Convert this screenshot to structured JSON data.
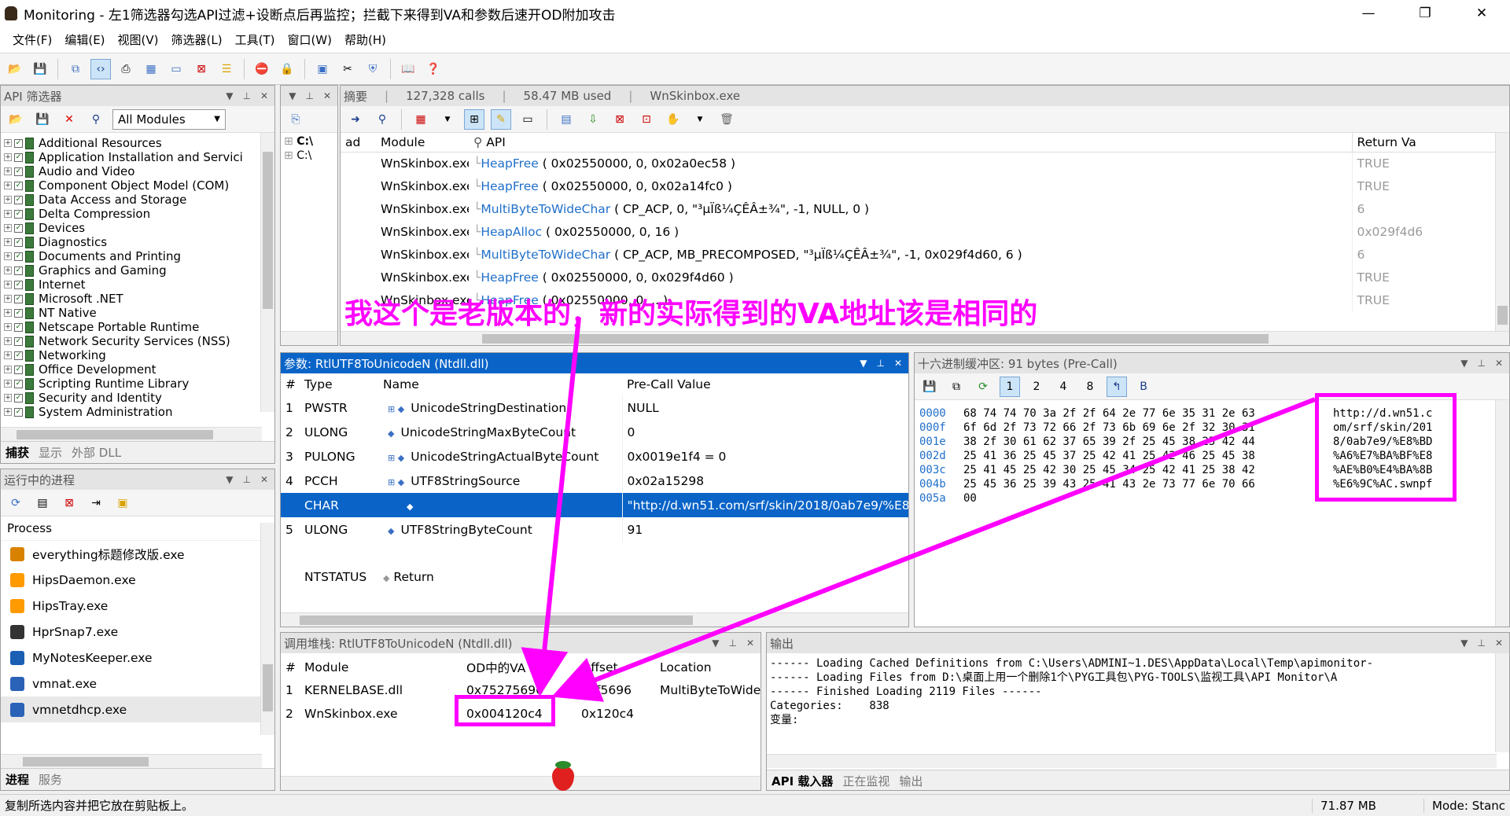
{
  "window": {
    "title": "Monitoring - 左1筛选器勾选API过滤+设断点后再监控；拦截下来得到VA和参数后速开OD附加攻击",
    "min": "—",
    "max": "❐",
    "close": "✕"
  },
  "menu": [
    "文件(F)",
    "编辑(E)",
    "视图(V)",
    "筛选器(L)",
    "工具(T)",
    "窗口(W)",
    "帮助(H)"
  ],
  "api_filter": {
    "title": "API 筛选器",
    "module_select": "All Modules",
    "items": [
      "Additional Resources",
      "Application Installation and Servici",
      "Audio and Video",
      "Component Object Model (COM)",
      "Data Access and Storage",
      "Delta Compression",
      "Devices",
      "Diagnostics",
      "Documents and Printing",
      "Graphics and Gaming",
      "Internet",
      "Microsoft .NET",
      "NT Native",
      "Netscape Portable Runtime",
      "Network Security Services (NSS)",
      "Networking",
      "Office Development",
      "Scripting Runtime Library",
      "Security and Identity",
      "System Administration"
    ],
    "tabs": [
      "捕获",
      "显示",
      "外部 DLL"
    ]
  },
  "processes": {
    "title": "运行中的进程",
    "header": "Process",
    "items": [
      "everything标题修改版.exe",
      "HipsDaemon.exe",
      "HipsTray.exe",
      "HprSnap7.exe",
      "MyNotesKeeper.exe",
      "vmnat.exe",
      "vmnetdhcp.exe"
    ],
    "tabs": [
      "进程",
      "服务"
    ]
  },
  "summary": {
    "title": "摘要",
    "calls": "127,328 calls",
    "mem": "58.47 MB used",
    "process": "WnSkinbox.exe"
  },
  "left_tree": {
    "c1": "C:\\",
    "c2": "C:\\"
  },
  "calls": {
    "col_ad": "ad",
    "col_module": "Module",
    "col_api": "API",
    "col_ret": "Return Va",
    "rows": [
      {
        "module": "WnSkinbox.exe",
        "fn": "HeapFree",
        "args": " ( 0x02550000, 0, 0x02a0ec58 )",
        "ret": "TRUE"
      },
      {
        "module": "WnSkinbox.exe",
        "fn": "HeapFree",
        "args": " ( 0x02550000, 0, 0x02a14fc0 )",
        "ret": "TRUE"
      },
      {
        "module": "WnSkinbox.exe",
        "fn": "MultiByteToWideChar",
        "args": " ( CP_ACP, 0, \"³µÏß¼ÇÊÂ±¾\", -1, NULL, 0 )",
        "ret": "6"
      },
      {
        "module": "WnSkinbox.exe",
        "fn": "HeapAlloc",
        "args": " ( 0x02550000, 0, 16 )",
        "ret": "0x029f4d6"
      },
      {
        "module": "WnSkinbox.exe",
        "fn": "MultiByteToWideChar",
        "args": " ( CP_ACP, MB_PRECOMPOSED, \"³µÏß¼ÇÊÂ±¾\", -1, 0x029f4d60, 6 )",
        "ret": "6"
      },
      {
        "module": "WnSkinbox.exe",
        "fn": "HeapFree",
        "args": " ( 0x02550000, 0, 0x029f4d60 )",
        "ret": "TRUE"
      },
      {
        "module": "WnSkinbox.exe",
        "fn": "HeapFree",
        "args": " ( 0x02550000, 0, ...)",
        "ret": "TRUE"
      }
    ]
  },
  "annotation": "我这个是老版本的，新的实际得到的VA地址该是相同的",
  "params": {
    "title": "参数: RtlUTF8ToUnicodeN (Ntdll.dll)",
    "col_num": "#",
    "col_type": "Type",
    "col_name": "Name",
    "col_val": "Pre-Call Value",
    "rows": [
      {
        "n": "1",
        "type": "PWSTR",
        "name": "UnicodeStringDestination",
        "val": "NULL"
      },
      {
        "n": "2",
        "type": "ULONG",
        "name": "UnicodeStringMaxByteCount",
        "val": "0"
      },
      {
        "n": "3",
        "type": "PULONG",
        "name": "UnicodeStringActualByteCount",
        "val": "0x0019e1f4 = 0"
      },
      {
        "n": "4",
        "type": "PCCH",
        "name": "UTF8StringSource",
        "val": "0x02a15298"
      },
      {
        "n": "",
        "type": "CHAR",
        "name": "",
        "val": "\"http://d.wn51.com/srf/skin/2018/0ab7e9/%E8%"
      },
      {
        "n": "5",
        "type": "ULONG",
        "name": "UTF8StringByteCount",
        "val": "91"
      }
    ],
    "ret_type": "NTSTATUS",
    "ret_name": "Return"
  },
  "hex": {
    "title": "十六进制缓冲区: 91 bytes (Pre-Call)",
    "offsets": [
      "0000",
      "000f",
      "001e",
      "002d",
      "003c",
      "004b",
      "005a"
    ],
    "bytes": [
      "68 74 74 70 3a 2f 2f 64 2e 77 6e 35 31 2e 63",
      "6f 6d 2f 73 72 66 2f 73 6b 69 6e 2f 32 30 31",
      "38 2f 30 61 62 37 65 39 2f 25 45 38 25 42 44",
      "25 41 36 25 45 37 25 42 41 25 42 46 25 45 38",
      "25 41 45 25 42 30 25 45 34 25 42 41 25 38 42",
      "25 45 36 25 39 43 25 41 43 2e 73 77 6e 70 66",
      "00"
    ],
    "ascii": [
      "http://d.wn51.c",
      "om/srf/skin/201",
      "8/0ab7e9/%E8%BD",
      "%A6%E7%BA%BF%E8",
      "%AE%B0%E4%BA%8B",
      "%E6%9C%AC.swnpf",
      ""
    ]
  },
  "callstack": {
    "title": "调用堆栈: RtlUTF8ToUnicodeN (Ntdll.dll)",
    "col_num": "#",
    "col_module": "Module",
    "col_va": "OD中的VA",
    "col_off": "Offset",
    "col_loc": "Location",
    "rows": [
      {
        "n": "1",
        "module": "KERNELBASE.dll",
        "va": "0x75275696",
        "off": "0xf5696",
        "loc": "MultiByteToWide"
      },
      {
        "n": "2",
        "module": "WnSkinbox.exe",
        "va": "0x004120c4",
        "off": "0x120c4",
        "loc": ""
      }
    ]
  },
  "output": {
    "title": "输出",
    "lines": [
      "------ Loading Cached Definitions from C:\\Users\\ADMINI~1.DES\\AppData\\Local\\Temp\\apimonitor-",
      "------ Loading Files from D:\\桌面上用一个删除1个\\PYG工具包\\PYG-TOOLS\\监视工具\\API Monitor\\A",
      "------ Finished Loading 2119 Files ------",
      "Categories:    838",
      "变量:"
    ],
    "tabs": [
      "API 载入器",
      "正在监视",
      "输出"
    ]
  },
  "status": {
    "msg": "复制所选内容并把它放在剪贴板上。",
    "mem": "71.87 MB",
    "mode": "Mode: Stanc"
  },
  "colors": {
    "accent": "#0a64c8",
    "annotation": "#ff00ff"
  }
}
